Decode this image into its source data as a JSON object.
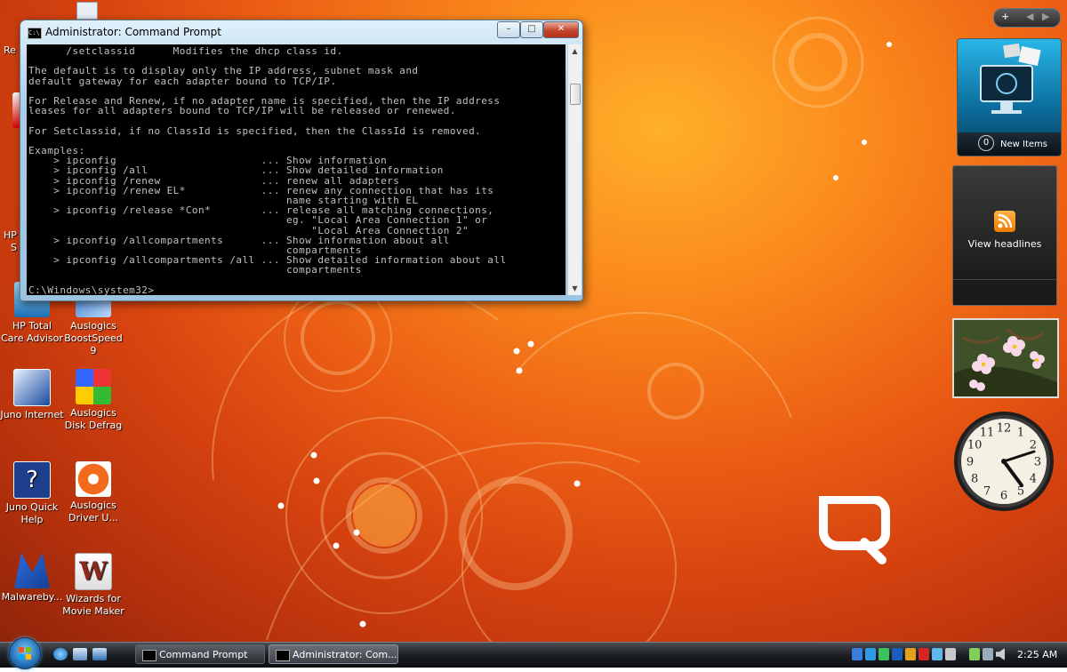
{
  "console_window": {
    "title": "Administrator: Command Prompt",
    "lines": [
      "      /setclassid      Modifies the dhcp class id.",
      "",
      "The default is to display only the IP address, subnet mask and",
      "default gateway for each adapter bound to TCP/IP.",
      "",
      "For Release and Renew, if no adapter name is specified, then the IP address",
      "leases for all adapters bound to TCP/IP will be released or renewed.",
      "",
      "For Setclassid, if no ClassId is specified, then the ClassId is removed.",
      "",
      "Examples:",
      "    > ipconfig                       ... Show information",
      "    > ipconfig /all                  ... Show detailed information",
      "    > ipconfig /renew                ... renew all adapters",
      "    > ipconfig /renew EL*            ... renew any connection that has its",
      "                                         name starting with EL",
      "    > ipconfig /release *Con*        ... release all matching connections,",
      "                                         eg. \"Local Area Connection 1\" or",
      "                                             \"Local Area Connection 2\"",
      "    > ipconfig /allcompartments      ... Show information about all",
      "                                         compartments",
      "    > ipconfig /allcompartments /all ... Show detailed information about all",
      "                                         compartments",
      "",
      "C:\\Windows\\system32>"
    ]
  },
  "desktop_icons": [
    {
      "label": "HP Total Care Advisor"
    },
    {
      "label": "Auslogics BoostSpeed 9"
    },
    {
      "label": "Juno Internet"
    },
    {
      "label": "Auslogics Disk Defrag"
    },
    {
      "label": "Juno Quick Help"
    },
    {
      "label": "Auslogics Driver U..."
    },
    {
      "label": "Malwareby..."
    },
    {
      "label": "Wizards for Movie Maker"
    }
  ],
  "partial_labels": {
    "re": "Re",
    "hp": "HP",
    "s": "S"
  },
  "sidebar": {
    "hp_gadget": {
      "count": "0",
      "label": "New Items"
    },
    "rss_gadget": {
      "label": "View headlines"
    },
    "clock_numbers": [
      "12",
      "1",
      "2",
      "3",
      "4",
      "5",
      "6",
      "7",
      "8",
      "9",
      "10",
      "11"
    ]
  },
  "taskbar": {
    "buttons": [
      {
        "label": "Command Prompt"
      },
      {
        "label": "Administrator: Com..."
      }
    ],
    "time": "2:25 AM"
  }
}
